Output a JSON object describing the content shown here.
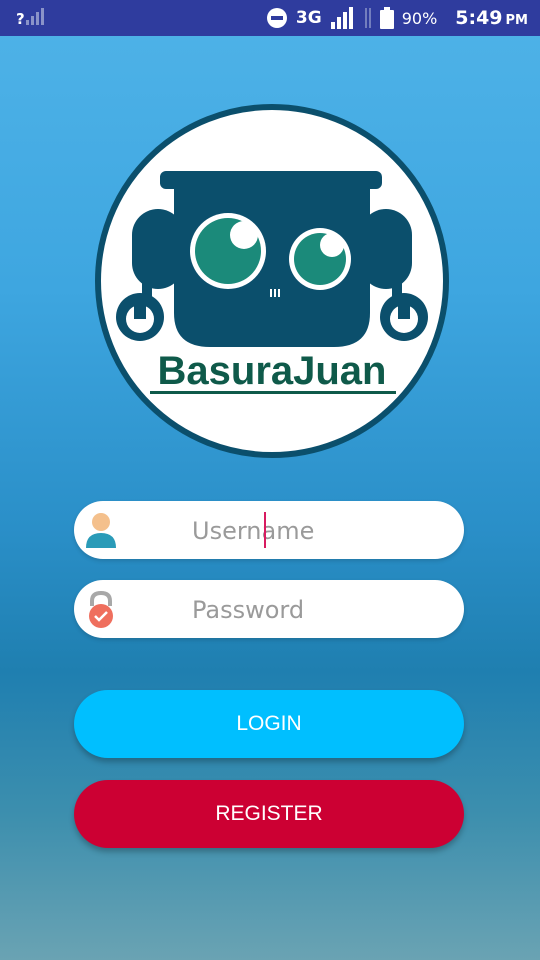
{
  "status_bar": {
    "network_type": "3G",
    "battery_percent": "90%",
    "time": "5:49",
    "ampm": "PM",
    "sim_icon_label": "?"
  },
  "logo": {
    "brand_name": "BasuraJuan",
    "icon": "robot-logo-icon",
    "colors": {
      "primary": "#0b4f6c",
      "eye": "#1b8a7a",
      "text": "#0f5a4a"
    }
  },
  "form": {
    "username": {
      "value": "",
      "placeholder": "Username",
      "icon": "user-icon"
    },
    "password": {
      "value": "",
      "placeholder": "Password",
      "icon": "lock-icon"
    }
  },
  "buttons": {
    "login_label": "LOGIN",
    "register_label": "REGISTER",
    "login_color": "#00bfff",
    "register_color": "#cc0033"
  }
}
